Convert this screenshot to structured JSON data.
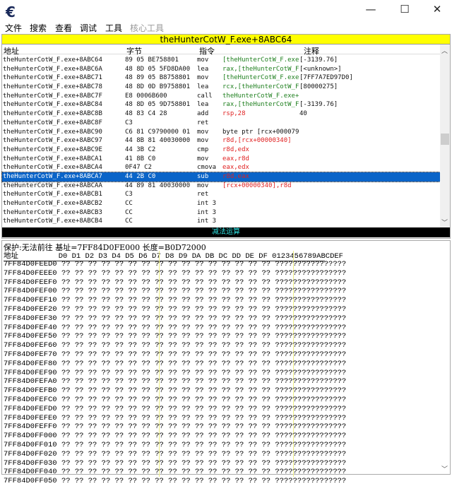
{
  "window": {
    "icon": "cheat-engine-logo",
    "minimize": "—",
    "maximize": "☐",
    "close": "✕"
  },
  "menu": [
    "文件",
    "搜索",
    "查看",
    "调试",
    "工具",
    "核心工具"
  ],
  "disasm": {
    "title": "theHunterCotW_F.exe+8ABC64",
    "columns": [
      "地址",
      "字节",
      "指令",
      "注释"
    ],
    "rows": [
      {
        "addr": "theHunterCotW_F.exe+8ABC64",
        "bytes": "89 05 BE758801",
        "op": "mov",
        "args": "[theHunterCotW_F.exe+1",
        "comment": "[-3139.76]"
      },
      {
        "addr": "theHunterCotW_F.exe+8ABC6A",
        "bytes": "48 8D 05 5FD8DA00",
        "op": "lea",
        "args": "rax,[theHunterCotW_F.e",
        "comment": "[<unknown>]"
      },
      {
        "addr": "theHunterCotW_F.exe+8ABC71",
        "bytes": "48 89 05 B8758801",
        "op": "mov",
        "args": "[theHunterCotW_F.exe+1",
        "comment": "[7FF7A7ED97D0]"
      },
      {
        "addr": "theHunterCotW_F.exe+8ABC78",
        "bytes": "48 8D 0D B9758801",
        "op": "lea",
        "args": "rcx,[theHunterCotW_F.e",
        "comment": "[80000275]"
      },
      {
        "addr": "theHunterCotW_F.exe+8ABC7F",
        "bytes": "E8 0006B600",
        "op": "call",
        "args": "theHunterCotW_F.exe+14",
        "comment": ""
      },
      {
        "addr": "theHunterCotW_F.exe+8ABC84",
        "bytes": "48 8D 05 9D758801",
        "op": "lea",
        "args": "rax,[theHunterCotW_F.e",
        "comment": "[-3139.76]"
      },
      {
        "addr": "theHunterCotW_F.exe+8ABC8B",
        "bytes": "48 83 C4 28",
        "op": "add",
        "args": "rsp,28",
        "comment": "40"
      },
      {
        "addr": "theHunterCotW_F.exe+8ABC8F",
        "bytes": "C3",
        "op": "ret",
        "args": "",
        "comment": ""
      },
      {
        "addr": "theHunterCotW_F.exe+8ABC90",
        "bytes": "C6 81 C9790000 01",
        "op": "mov",
        "args": "byte ptr [rcx+000079C9],1",
        "comment": ""
      },
      {
        "addr": "theHunterCotW_F.exe+8ABC97",
        "bytes": "44 8B 81 40030000",
        "op": "mov",
        "args": "r8d,[rcx+00000340]",
        "comment": ""
      },
      {
        "addr": "theHunterCotW_F.exe+8ABC9E",
        "bytes": "44 3B C2",
        "op": "cmp",
        "args": "r8d,edx",
        "comment": ""
      },
      {
        "addr": "theHunterCotW_F.exe+8ABCA1",
        "bytes": "41 8B C0",
        "op": "mov",
        "args": "eax,r8d",
        "comment": ""
      },
      {
        "addr": "theHunterCotW_F.exe+8ABCA4",
        "bytes": "0F47 C2",
        "op": "cmova",
        "args": "eax,edx",
        "comment": ""
      },
      {
        "addr": "theHunterCotW_F.exe+8ABCA7",
        "bytes": "44 2B C0",
        "op": "sub",
        "args": "r8d,eax",
        "comment": "",
        "selected": true
      },
      {
        "addr": "theHunterCotW_F.exe+8ABCAA",
        "bytes": "44 89 81 40030000",
        "op": "mov",
        "args": "[rcx+00000340],r8d",
        "comment": ""
      },
      {
        "addr": "theHunterCotW_F.exe+8ABCB1",
        "bytes": "C3",
        "op": "ret",
        "args": "",
        "comment": ""
      },
      {
        "addr": "theHunterCotW_F.exe+8ABCB2",
        "bytes": "CC",
        "op": "int 3",
        "args": "",
        "comment": ""
      },
      {
        "addr": "theHunterCotW_F.exe+8ABCB3",
        "bytes": "CC",
        "op": "int 3",
        "args": "",
        "comment": ""
      },
      {
        "addr": "theHunterCotW_F.exe+8ABCB4",
        "bytes": "CC",
        "op": "int 3",
        "args": "",
        "comment": ""
      }
    ],
    "status": "减法运算"
  },
  "colors": {
    "title_bg": "#ffff00",
    "selection": "#0a64c8",
    "register": "#e02020",
    "number": "#2020e0",
    "symbol": "#208020",
    "status_bg": "#000000",
    "status_fg": "#2ee0e0"
  },
  "hex": {
    "info": "保护:无法前往   基址=7FF84D0FE000 长度=B0D72000",
    "header_label": "地址",
    "header_cols": "D0 D1 D2 D3 D4 D5 D6 D7 D8 D9 DA DB DC DD DE DF 0123456789ABCDEF",
    "bytes": "?? ?? ?? ?? ?? ?? ?? ?? ?? ?? ?? ?? ?? ?? ?? ??",
    "ascii": "????????????????",
    "addresses": [
      "7FF84D0FEED0",
      "7FF84D0FEEE0",
      "7FF84D0FEEF0",
      "7FF84D0FEF00",
      "7FF84D0FEF10",
      "7FF84D0FEF20",
      "7FF84D0FEF30",
      "7FF84D0FEF40",
      "7FF84D0FEF50",
      "7FF84D0FEF60",
      "7FF84D0FEF70",
      "7FF84D0FEF80",
      "7FF84D0FEF90",
      "7FF84D0FEFA0",
      "7FF84D0FEFB0",
      "7FF84D0FEFC0",
      "7FF84D0FEFD0",
      "7FF84D0FEFE0",
      "7FF84D0FEFF0",
      "7FF84D0FF000",
      "7FF84D0FF010",
      "7FF84D0FF020",
      "7FF84D0FF030",
      "7FF84D0FF040",
      "7FF84D0FF050"
    ]
  }
}
